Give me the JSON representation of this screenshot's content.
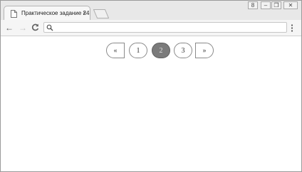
{
  "browser": {
    "tab_title": "Практическое задание 24",
    "tab_close": "×",
    "window_buttons": {
      "user": "8",
      "minimize": "–",
      "maximize": "❐",
      "close": "✕"
    }
  },
  "toolbar": {
    "back": "←",
    "forward": "→",
    "reload": "C",
    "address_value": "",
    "menu_icon": "kebab-menu-icon"
  },
  "pagination": {
    "prev_label": "«",
    "pages": [
      "1",
      "2",
      "3"
    ],
    "active_page": "2",
    "next_label": "»"
  }
}
